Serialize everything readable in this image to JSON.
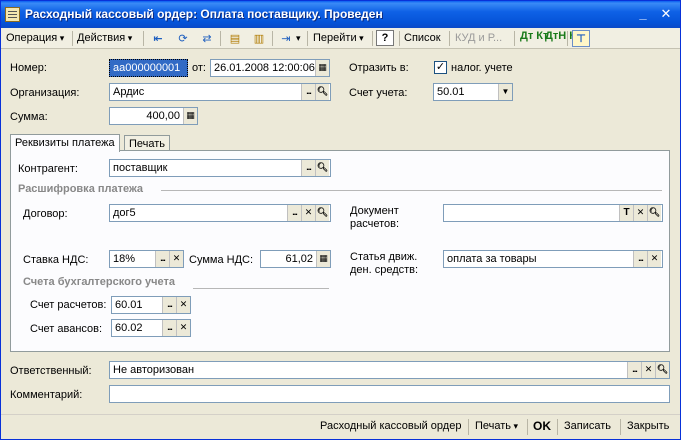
{
  "window": {
    "title": "Расходный кассовый ордер: Оплата поставщику. Проведен",
    "minimize_glyph": "_",
    "close_glyph": "✕"
  },
  "toolbar": {
    "operation": "Операция",
    "actions": "Действия",
    "goto": "Перейти",
    "help": "?",
    "list": "Список",
    "kudir": "КУД и Р...",
    "dt_kt": "Дт Кт",
    "dt_kt_n": "ДтН Кт"
  },
  "header": {
    "number_label": "Номер:",
    "number_value": "аа000000001",
    "from_label": "от:",
    "date_value": "26.01.2008 12:00:06",
    "reflect_label": "Отразить в:",
    "tax_check": "✓",
    "tax_label": "налог. учете",
    "org_label": "Организация:",
    "org_value": "Ардис",
    "account_label": "Счет учета:",
    "account_value": "50.01",
    "sum_label": "Сумма:",
    "sum_value": "400,00"
  },
  "tabs": [
    {
      "label": "Реквизиты платежа"
    },
    {
      "label": "Печать"
    }
  ],
  "payment": {
    "counterparty_label": "Контрагент:",
    "counterparty_value": "поставщик",
    "breakdown_title": "Расшифровка платежа",
    "contract_label": "Договор:",
    "contract_value": "дог5",
    "doc_label_1": "Документ",
    "doc_label_2": "расчетов:",
    "doc_value": "",
    "vat_rate_label": "Ставка НДС:",
    "vat_rate_value": "18%",
    "vat_sum_label": "Сумма НДС:",
    "vat_sum_value": "61,02",
    "cashflow_label_1": "Статья движ.",
    "cashflow_label_2": "ден. средств:",
    "cashflow_value": "оплата за товары",
    "accounts_title": "Счета бухгалтерского учета",
    "settle_label": "Счет расчетов:",
    "settle_value": "60.01",
    "advance_label": "Счет авансов:",
    "advance_value": "60.02"
  },
  "footer": {
    "responsible_label": "Ответственный:",
    "responsible_value": "Не авторизован",
    "comment_label": "Комментарий:",
    "comment_value": ""
  },
  "bottom": {
    "print_form": "Расходный кассовый ордер",
    "print": "Печать",
    "ok": "OK",
    "save": "Записать",
    "close": "Закрыть"
  }
}
